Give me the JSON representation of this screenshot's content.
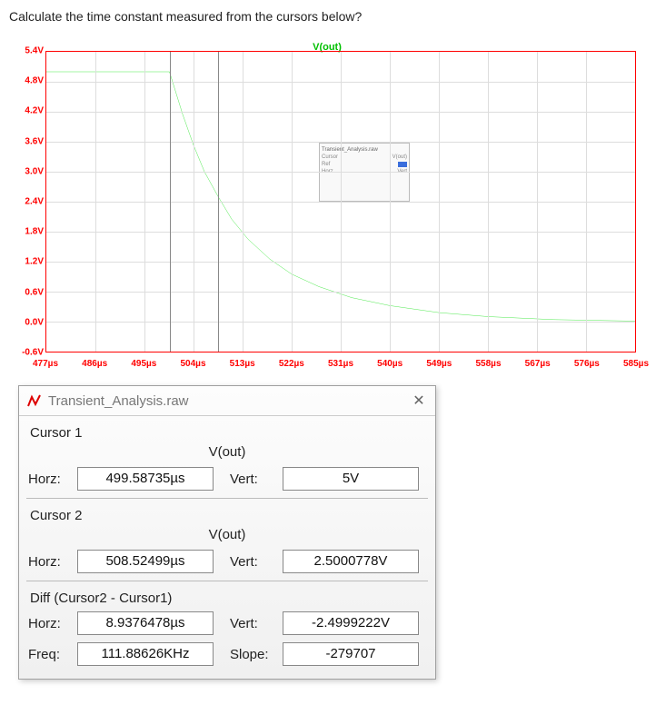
{
  "question": "Calculate the time constant measured from the cursors below?",
  "chart_data": {
    "type": "line",
    "title": "V(out)",
    "xlabel": "",
    "ylabel": "",
    "x_ticks": [
      "477µs",
      "486µs",
      "495µs",
      "504µs",
      "513µs",
      "522µs",
      "531µs",
      "540µs",
      "549µs",
      "558µs",
      "567µs",
      "576µs",
      "585µs"
    ],
    "y_ticks": [
      "-0.6V",
      "0.0V",
      "0.6V",
      "1.2V",
      "1.8V",
      "2.4V",
      "3.0V",
      "3.6V",
      "4.2V",
      "4.8V",
      "5.4V"
    ],
    "xlim": [
      477,
      585
    ],
    "ylim": [
      -0.6,
      5.4
    ],
    "cursors_x": [
      499.58735,
      508.52499
    ],
    "series": [
      {
        "name": "V(out)",
        "color": "#00e000",
        "x": [
          477,
          486,
          495,
          499.587,
          502,
          504,
          506,
          508.525,
          511,
          514,
          518,
          522,
          527,
          533,
          540,
          549,
          558,
          570,
          585
        ],
        "y": [
          5.0,
          5.0,
          5.0,
          5.0,
          4.15,
          3.53,
          3.0,
          2.5,
          2.05,
          1.65,
          1.25,
          0.95,
          0.7,
          0.48,
          0.32,
          0.18,
          0.1,
          0.04,
          0.01
        ]
      }
    ]
  },
  "dialog": {
    "title": "Transient_Analysis.raw",
    "cursor1_label": "Cursor 1",
    "cursor2_label": "Cursor 2",
    "diff_label": "Diff (Cursor2 - Cursor1)",
    "signal_label": "V(out)",
    "horz_label": "Horz:",
    "vert_label": "Vert:",
    "freq_label": "Freq:",
    "slope_label": "Slope:",
    "cursor1": {
      "horz": "499.58735µs",
      "vert": "5V"
    },
    "cursor2": {
      "horz": "508.52499µs",
      "vert": "2.5000778V"
    },
    "diff": {
      "horz": "8.9376478µs",
      "vert": "-2.4999222V"
    },
    "freq": "111.88626KHz",
    "slope": "-279707"
  }
}
